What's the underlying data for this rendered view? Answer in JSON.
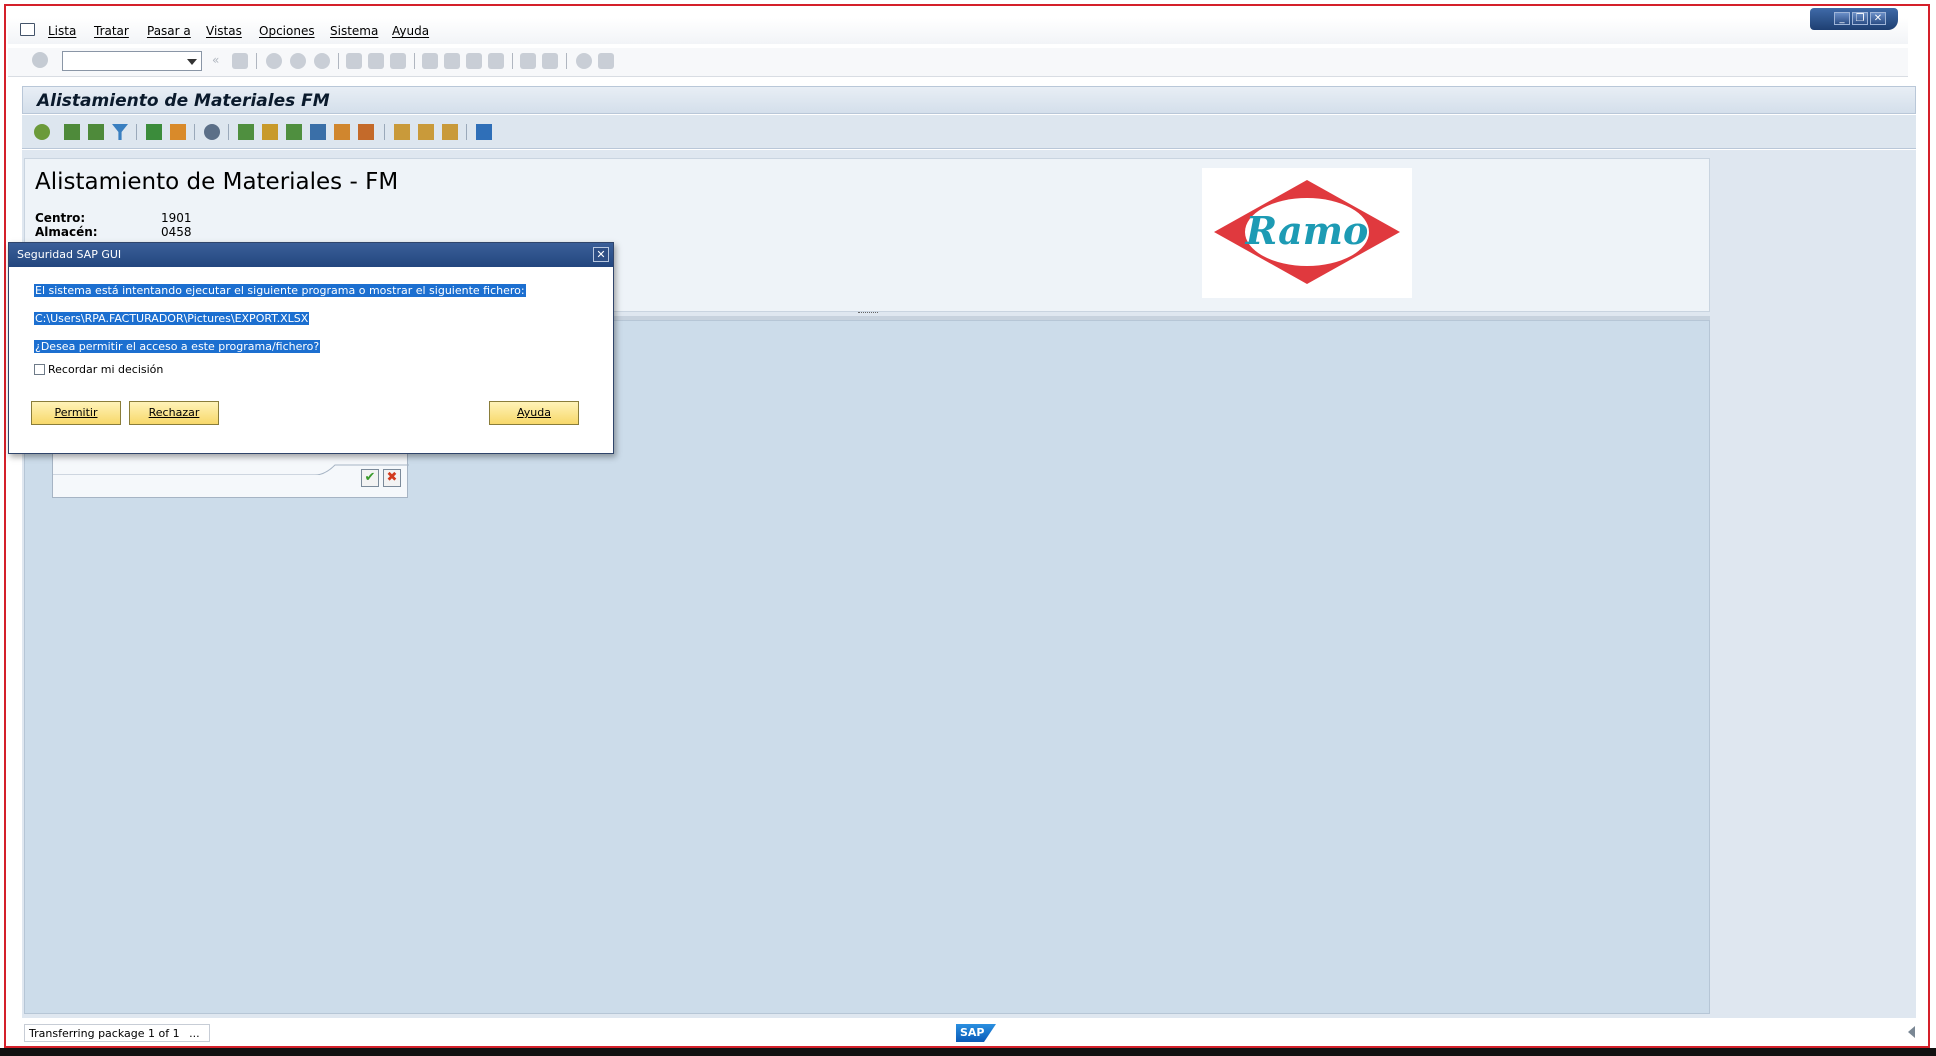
{
  "menu": {
    "items": [
      "Lista",
      "Tratar",
      "Pasar a",
      "Vistas",
      "Opciones",
      "Sistema",
      "Ayuda"
    ]
  },
  "window_controls": {
    "minimize": "_",
    "restore": "❐",
    "close": "✕"
  },
  "command_field": {
    "value": ""
  },
  "title_bar": {
    "title": "Alistamiento de Materiales FM"
  },
  "header": {
    "report_title": "Alistamiento de Materiales - FM",
    "fields": [
      {
        "label": "Centro:",
        "value": "1901"
      },
      {
        "label": "Almacén:",
        "value": "0458"
      }
    ],
    "logo_text": "Ramo"
  },
  "dialog": {
    "title": "Seguridad SAP GUI",
    "close": "✕",
    "message": "El sistema está intentando ejecutar el siguiente programa o mostrar el siguiente fichero:",
    "file_path": "C:\\Users\\RPA.FACTURADOR\\Pictures\\EXPORT.XLSX",
    "question": "¿Desea permitir el acceso a este programa/fichero?",
    "remember_label": "Recordar mi decisión",
    "buttons": {
      "allow": "Permitir",
      "reject": "Rechazar",
      "help": "Ayuda"
    }
  },
  "small_popup": {
    "ok": "✔",
    "cancel": "✖"
  },
  "status_bar": {
    "text": "Transferring package 1  of 1",
    "more": "...",
    "brand": "SAP"
  },
  "colors": {
    "frame_border": "#d4202a",
    "dialog_titlebar": "#23467e",
    "selection": "#1c6fd0",
    "button_face": "#f7d86a",
    "logo_red": "#e0393e",
    "logo_teal": "#1d9bb4"
  }
}
